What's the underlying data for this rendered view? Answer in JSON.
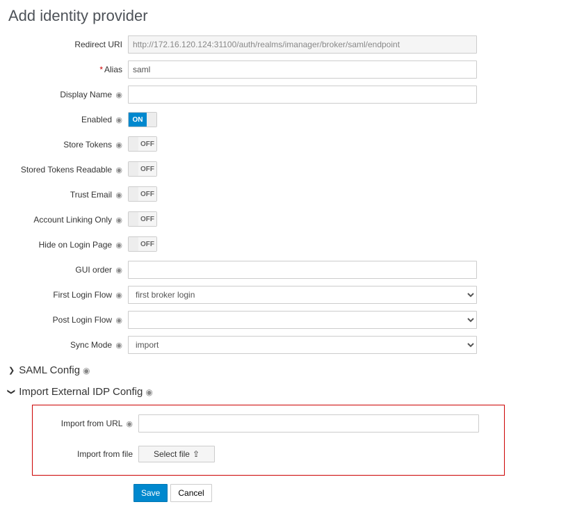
{
  "page_title": "Add identity provider",
  "labels": {
    "redirect_uri": "Redirect URI",
    "alias": "Alias",
    "display_name": "Display Name",
    "enabled": "Enabled",
    "store_tokens": "Store Tokens",
    "stored_tokens_readable": "Stored Tokens Readable",
    "trust_email": "Trust Email",
    "account_linking_only": "Account Linking Only",
    "hide_on_login": "Hide on Login Page",
    "gui_order": "GUI order",
    "first_login_flow": "First Login Flow",
    "post_login_flow": "Post Login Flow",
    "sync_mode": "Sync Mode",
    "import_from_url": "Import from URL",
    "import_from_file": "Import from file"
  },
  "values": {
    "redirect_uri": "http://172.16.120.124:31100/auth/realms/imanager/broker/saml/endpoint",
    "alias": "saml",
    "display_name": "",
    "enabled": true,
    "store_tokens": false,
    "stored_tokens_readable": false,
    "trust_email": false,
    "account_linking_only": false,
    "hide_on_login": false,
    "gui_order": "",
    "first_login_flow": "first broker login",
    "post_login_flow": "",
    "sync_mode": "import",
    "import_from_url": ""
  },
  "toggle_text": {
    "on": "ON",
    "off": "OFF"
  },
  "sections": {
    "saml_config": "SAML Config",
    "import_external": "Import External IDP Config"
  },
  "buttons": {
    "select_file": "Select file",
    "save": "Save",
    "cancel": "Cancel"
  }
}
